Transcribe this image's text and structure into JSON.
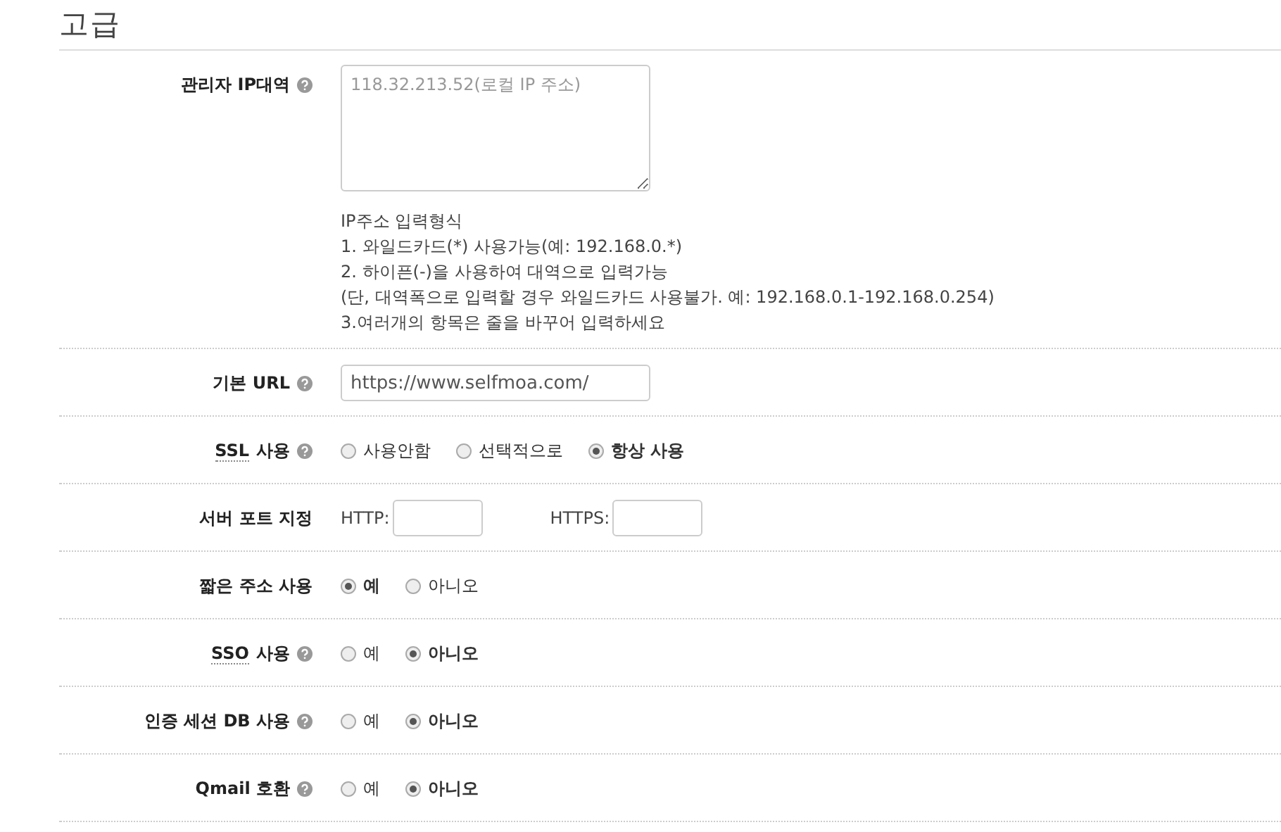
{
  "heading": "고급",
  "rows": [
    {
      "kind": "textarea",
      "label": "관리자 IP대역",
      "help": true,
      "placeholder": "118.32.213.52(로컬 IP 주소)",
      "notes": [
        "IP주소 입력형식",
        "1. 와일드카드(*) 사용가능(예: 192.168.0.*)",
        "2. 하이픈(-)을 사용하여 대역으로 입력가능",
        "(단, 대역폭으로 입력할 경우 와일드카드 사용불가. 예: 192.168.0.1-192.168.0.254)",
        "3.여러개의 항목은 줄을 바꾸어 입력하세요"
      ]
    },
    {
      "kind": "text",
      "label": "기본 URL",
      "help": true,
      "value": "https://www.selfmoa.com/"
    },
    {
      "kind": "radio",
      "abbr": "SSL",
      "label": "사용",
      "help": true,
      "options": [
        {
          "label": "사용안함",
          "selected": false
        },
        {
          "label": "선택적으로",
          "selected": false
        },
        {
          "label": "항상 사용",
          "selected": true
        }
      ]
    },
    {
      "kind": "ports",
      "label": "서버 포트 지정",
      "help": false,
      "ports": [
        {
          "label": "HTTP:"
        },
        {
          "label": "HTTPS:"
        }
      ]
    },
    {
      "kind": "radio",
      "label": "짧은 주소 사용",
      "help": false,
      "options": [
        {
          "label": "예",
          "selected": true
        },
        {
          "label": "아니오",
          "selected": false
        }
      ]
    },
    {
      "kind": "radio",
      "abbr": "SSO",
      "label": "사용",
      "help": true,
      "options": [
        {
          "label": "예",
          "selected": false
        },
        {
          "label": "아니오",
          "selected": true
        }
      ]
    },
    {
      "kind": "radio",
      "label": "인증 세션 DB 사용",
      "help": true,
      "options": [
        {
          "label": "예",
          "selected": false
        },
        {
          "label": "아니오",
          "selected": true
        }
      ]
    },
    {
      "kind": "radio",
      "label": "Qmail 호환",
      "help": true,
      "options": [
        {
          "label": "예",
          "selected": false
        },
        {
          "label": "아니오",
          "selected": true
        }
      ]
    }
  ]
}
